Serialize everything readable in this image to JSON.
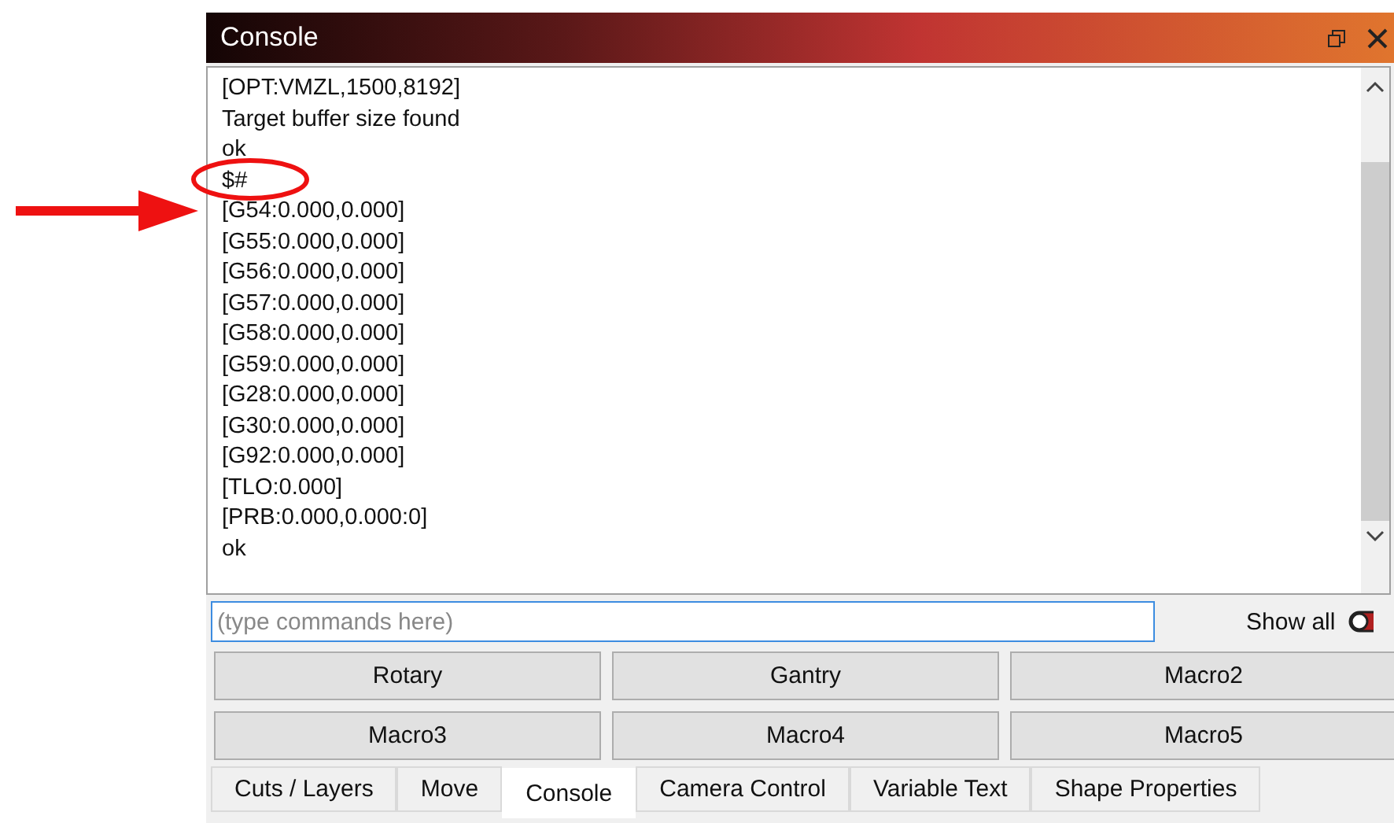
{
  "window": {
    "title": "Console"
  },
  "console": {
    "lines": [
      "[OPT:VMZL,1500,8192]",
      "Target buffer size found",
      "ok",
      "$#",
      "[G54:0.000,0.000]",
      "[G55:0.000,0.000]",
      "[G56:0.000,0.000]",
      "[G57:0.000,0.000]",
      "[G58:0.000,0.000]",
      "[G59:0.000,0.000]",
      "[G28:0.000,0.000]",
      "[G30:0.000,0.000]",
      "[G92:0.000,0.000]",
      "[TLO:0.000]",
      "[PRB:0.000,0.000:0]",
      "ok"
    ]
  },
  "command_input": {
    "placeholder": "(type commands here)"
  },
  "show_all": {
    "label": "Show all",
    "on": false
  },
  "buttons": [
    "Rotary",
    "Gantry",
    "Macro2",
    "Macro3",
    "Macro4",
    "Macro5"
  ],
  "tabs": [
    {
      "label": "Cuts / Layers",
      "selected": false
    },
    {
      "label": "Move",
      "selected": false
    },
    {
      "label": "Console",
      "selected": true
    },
    {
      "label": "Camera Control",
      "selected": false
    },
    {
      "label": "Variable Text",
      "selected": false
    },
    {
      "label": "Shape Properties",
      "selected": false
    }
  ]
}
